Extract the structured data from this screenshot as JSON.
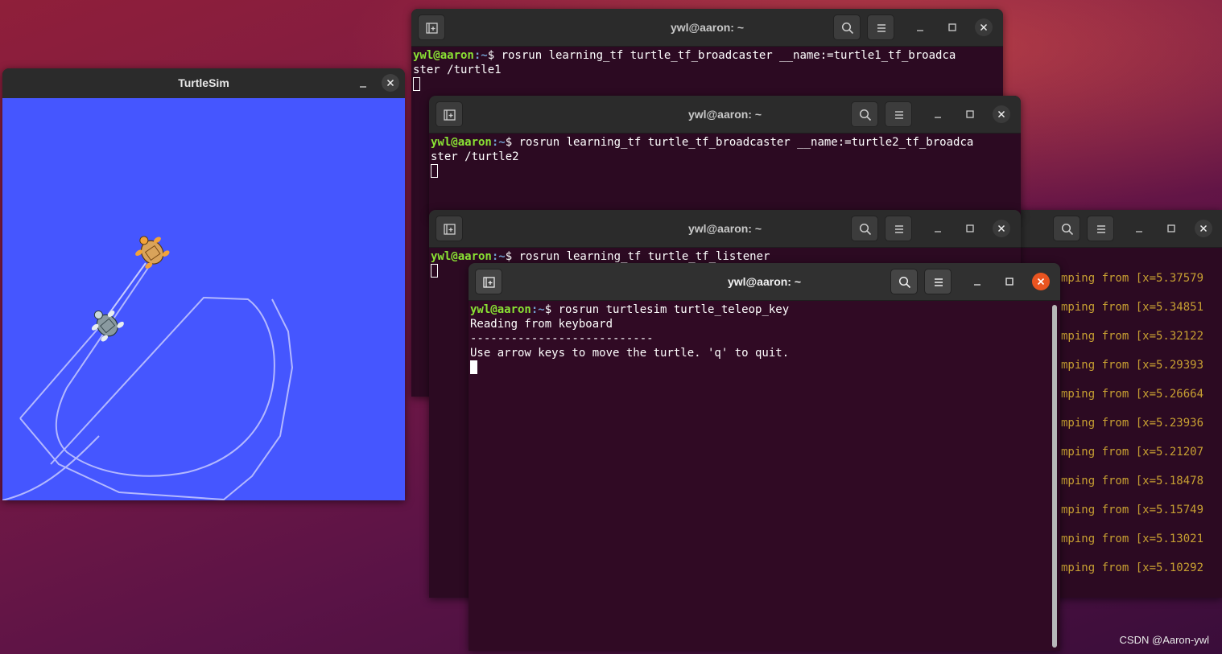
{
  "turtlesim": {
    "title": "TurtleSim",
    "colors": {
      "background": "#4556ff",
      "pen": "#b3b8ff"
    }
  },
  "terminals": [
    {
      "id": "t1",
      "title": "ywl@aaron: ~",
      "prompt_user": "ywl@aaron",
      "prompt_path": ":~",
      "prompt_sym": "$ ",
      "command_line1": "rosrun learning_tf turtle_tf_broadcaster __name:=turtle1_tf_broadca",
      "command_line2": "ster /turtle1"
    },
    {
      "id": "t2",
      "title": "ywl@aaron: ~",
      "prompt_user": "ywl@aaron",
      "prompt_path": ":~",
      "prompt_sym": "$ ",
      "command_line1": "rosrun learning_tf turtle_tf_broadcaster __name:=turtle2_tf_broadca",
      "command_line2": "ster /turtle2"
    },
    {
      "id": "t3",
      "title": "ywl@aaron: ~",
      "prompt_user": "ywl@aaron",
      "prompt_path": ":~",
      "prompt_sym": "$ ",
      "command_line1": "rosrun learning_tf turtle_tf_listener"
    },
    {
      "id": "t5",
      "title": "ywl@aaron: ~",
      "prompt_user": "ywl@aaron",
      "prompt_path": ":~",
      "prompt_sym": "$ ",
      "command_line1": "rosrun turtlesim turtle_teleop_key",
      "output": [
        "Reading from keyboard",
        "---------------------------",
        "Use arrow keys to move the turtle. 'q' to quit."
      ]
    }
  ],
  "background_terminal_log": [
    "mping from [x=5.37579",
    "mping from [x=5.34851",
    "mping from [x=5.32122",
    "mping from [x=5.29393",
    "mping from [x=5.26664",
    "mping from [x=5.23936",
    "mping from [x=5.21207",
    "mping from [x=5.18478",
    "mping from [x=5.15749",
    "mping from [x=5.13021",
    "mping from [x=5.10292"
  ],
  "watermark": "CSDN @Aaron-ywl",
  "icons": {
    "new_tab": "new-tab-icon",
    "search": "search-icon",
    "menu": "hamburger-menu-icon",
    "minimize": "minimize-icon",
    "maximize": "maximize-icon",
    "close": "close-icon"
  }
}
